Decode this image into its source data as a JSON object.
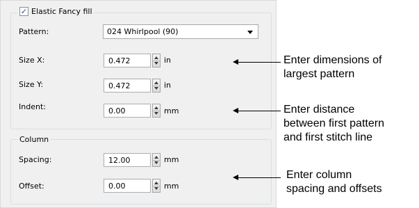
{
  "group1": {
    "checkbox_label": "Elastic Fancy fill",
    "checked": true,
    "pattern_label": "Pattern:",
    "pattern_value": "024 Whirlpool (90)",
    "size_x_label": "Size X:",
    "size_x_value": "0.472",
    "size_x_unit": "in",
    "size_y_label": "Size Y:",
    "size_y_value": "0.472",
    "size_y_unit": "in",
    "indent_label": "Indent:",
    "indent_value": "0.00",
    "indent_unit": "mm"
  },
  "group2": {
    "title": "Column",
    "spacing_label": "Spacing:",
    "spacing_value": "12.00",
    "spacing_unit": "mm",
    "offset_label": "Offset:",
    "offset_value": "0.00",
    "offset_unit": "mm"
  },
  "annotations": {
    "dimensions_line1": "Enter dimensions of",
    "dimensions_line2": "largest pattern",
    "distance_line1": "Enter distance",
    "distance_line2": "between first pattern",
    "distance_line3": "and first stitch line",
    "column_line1": "Enter column",
    "column_line2": "spacing and offsets"
  }
}
